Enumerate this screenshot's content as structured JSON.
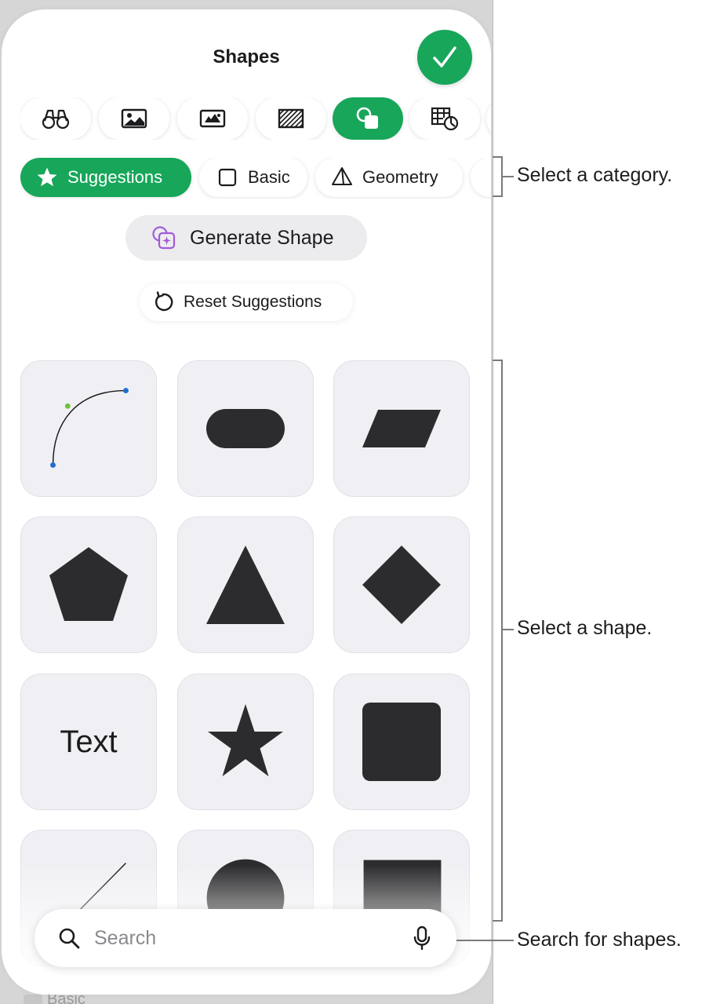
{
  "sheet": {
    "title": "Shapes",
    "done_icon": "checkmark-icon"
  },
  "tabs": [
    {
      "icon": "binoculars-icon",
      "active": false
    },
    {
      "icon": "photo-icon",
      "active": false
    },
    {
      "icon": "media-icon",
      "active": false
    },
    {
      "icon": "hatched-rectangle-icon",
      "active": false
    },
    {
      "icon": "shapes-icon",
      "active": true
    },
    {
      "icon": "table-chart-icon",
      "active": false
    }
  ],
  "categories": [
    {
      "label": "Suggestions",
      "icon": "star-icon",
      "active": true
    },
    {
      "label": "Basic",
      "icon": "square-icon",
      "active": false
    },
    {
      "label": "Geometry",
      "icon": "pyramid-icon",
      "active": false
    }
  ],
  "actions": {
    "generate_label": "Generate Shape",
    "reset_label": "Reset Suggestions"
  },
  "shapes": [
    {
      "name": "curve"
    },
    {
      "name": "rounded-rectangle"
    },
    {
      "name": "parallelogram"
    },
    {
      "name": "pentagon"
    },
    {
      "name": "triangle"
    },
    {
      "name": "diamond"
    },
    {
      "name": "text",
      "label": "Text"
    },
    {
      "name": "star"
    },
    {
      "name": "square"
    },
    {
      "name": "line"
    },
    {
      "name": "circle"
    },
    {
      "name": "rectangle"
    }
  ],
  "search": {
    "placeholder": "Search",
    "value": ""
  },
  "background_label": "Basic",
  "callouts": {
    "category": "Select a category.",
    "shape": "Select a shape.",
    "search": "Search for shapes."
  },
  "colors": {
    "accent": "#17a65a",
    "shape_fill": "#2c2c2e",
    "tile_bg": "#f0f0f4"
  }
}
